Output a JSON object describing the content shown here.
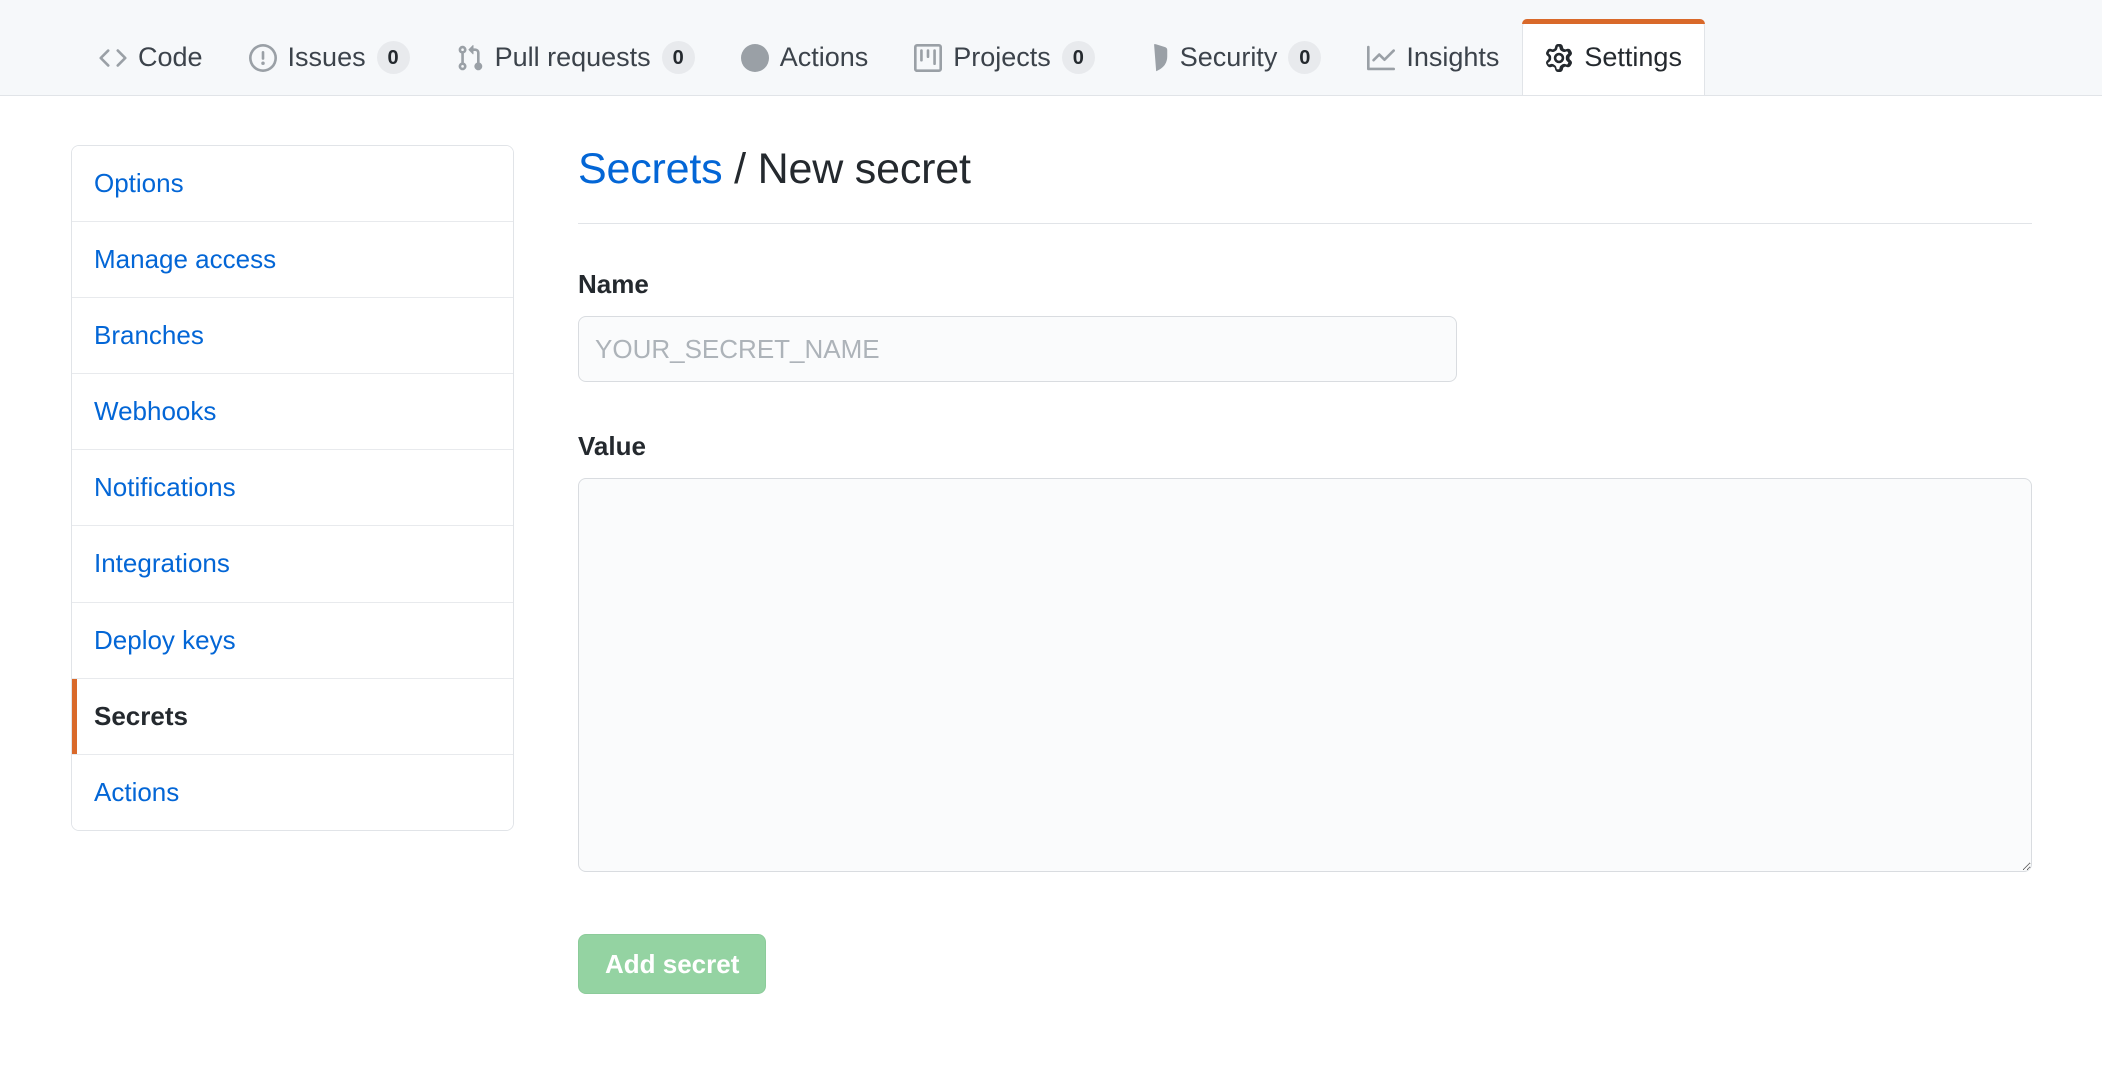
{
  "nav": {
    "tabs": [
      {
        "label": "Code",
        "icon": "code-icon",
        "count": null,
        "selected": false
      },
      {
        "label": "Issues",
        "icon": "issue-icon",
        "count": "0",
        "selected": false
      },
      {
        "label": "Pull requests",
        "icon": "git-pull-request-icon",
        "count": "0",
        "selected": false
      },
      {
        "label": "Actions",
        "icon": "play-icon",
        "count": null,
        "selected": false
      },
      {
        "label": "Projects",
        "icon": "project-icon",
        "count": "0",
        "selected": false
      },
      {
        "label": "Security",
        "icon": "shield-icon",
        "count": "0",
        "selected": false
      },
      {
        "label": "Insights",
        "icon": "graph-icon",
        "count": null,
        "selected": false
      },
      {
        "label": "Settings",
        "icon": "gear-icon",
        "count": null,
        "selected": true
      }
    ]
  },
  "sidebar": {
    "items": [
      {
        "label": "Options",
        "selected": false
      },
      {
        "label": "Manage access",
        "selected": false
      },
      {
        "label": "Branches",
        "selected": false
      },
      {
        "label": "Webhooks",
        "selected": false
      },
      {
        "label": "Notifications",
        "selected": false
      },
      {
        "label": "Integrations",
        "selected": false
      },
      {
        "label": "Deploy keys",
        "selected": false
      },
      {
        "label": "Secrets",
        "selected": true
      },
      {
        "label": "Actions",
        "selected": false
      }
    ]
  },
  "main": {
    "breadcrumb": {
      "parent": "Secrets",
      "separator": "/",
      "current": "New secret"
    },
    "name_field": {
      "label": "Name",
      "placeholder": "YOUR_SECRET_NAME",
      "value": ""
    },
    "value_field": {
      "label": "Value",
      "placeholder": "",
      "value": ""
    },
    "submit": {
      "label": "Add secret",
      "disabled": true
    }
  },
  "colors": {
    "accent_orange": "#d9692a",
    "link_blue": "#0366d6",
    "header_bg": "#f6f8fa",
    "border": "#e1e4e8",
    "button_green_disabled": "#94d3a2",
    "input_bg": "#fafbfc",
    "text_dark": "#24292e"
  }
}
